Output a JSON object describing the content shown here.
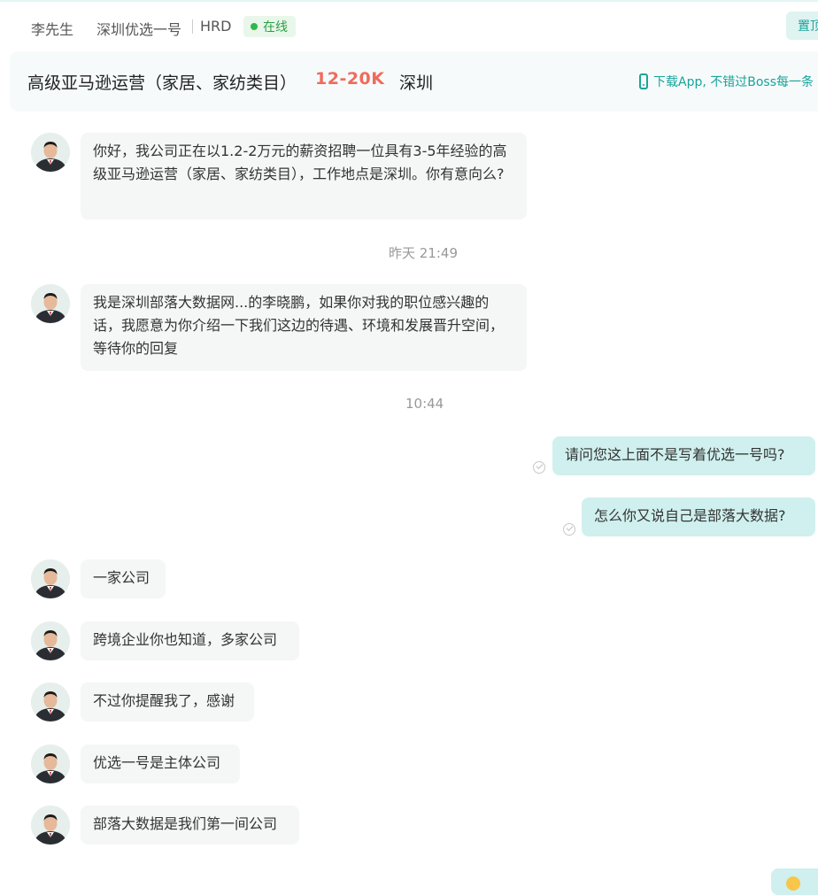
{
  "header": {
    "hr_name": "李先生",
    "company": "深圳优选一号",
    "role": "HRD",
    "status": "在线",
    "top_button": "置顶"
  },
  "job": {
    "title": "高级亚马逊运营（家居、家纺类目）",
    "salary": "12-20K",
    "city": "深圳",
    "download_tip": "下载App, 不错过Boss每一条"
  },
  "messages": [
    {
      "from": "hr",
      "text": "你好，我公司正在以1.2-2万元的薪资招聘一位具有3-5年经验的高级亚马逊运营（家居、家纺类目），工作地点是深圳。你有意向么?"
    },
    {
      "type": "time",
      "text": "昨天 21:49"
    },
    {
      "from": "hr",
      "text": "我是深圳部落大数据网...的李晓鹏，如果你对我的职位感兴趣的话，我愿意为你介绍一下我们这边的待遇、环境和发展晋升空间，等待你的回复"
    },
    {
      "type": "time",
      "text": "10:44"
    },
    {
      "from": "me",
      "text": "请问您这上面不是写着优选一号吗?"
    },
    {
      "from": "me",
      "text": "怎么你又说自己是部落大数据?"
    },
    {
      "from": "hr",
      "text": "一家公司"
    },
    {
      "from": "hr",
      "text": "跨境企业你也知道，多家公司"
    },
    {
      "from": "hr",
      "text": "不过你提醒我了，感谢"
    },
    {
      "from": "hr",
      "text": "优选一号是主体公司"
    },
    {
      "from": "hr",
      "text": "部落大数据是我们第一间公司"
    }
  ],
  "colors": {
    "accent": "#1ba39b",
    "salary": "#f06b5b",
    "outgoing_bubble": "#cff0ee",
    "incoming_bubble": "#f5f6f6",
    "online": "#2fb84a"
  }
}
